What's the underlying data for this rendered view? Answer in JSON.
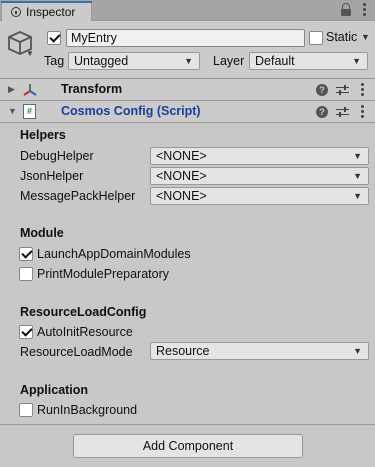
{
  "tab": {
    "label": "Inspector"
  },
  "header": {
    "object_name": "MyEntry",
    "active_checked": true,
    "static_label": "Static",
    "static_checked": false,
    "tag_label": "Tag",
    "tag_value": "Untagged",
    "layer_label": "Layer",
    "layer_value": "Default"
  },
  "components": {
    "transform": {
      "title": "Transform",
      "expanded": false
    },
    "cosmos": {
      "title": "Cosmos Config (Script)",
      "expanded": true,
      "enabled": false
    }
  },
  "sections": {
    "helpers": {
      "title": "Helpers",
      "fields": [
        {
          "label": "DebugHelper",
          "value": "<NONE>"
        },
        {
          "label": "JsonHelper",
          "value": "<NONE>"
        },
        {
          "label": "MessagePackHelper",
          "value": "<NONE>"
        }
      ]
    },
    "module": {
      "title": "Module",
      "toggles": [
        {
          "label": "LaunchAppDomainModules",
          "checked": true
        },
        {
          "label": "PrintModulePreparatory",
          "checked": false
        }
      ]
    },
    "resource": {
      "title": "ResourceLoadConfig",
      "toggles": [
        {
          "label": "AutoInitResource",
          "checked": true
        }
      ],
      "fields": [
        {
          "label": "ResourceLoadMode",
          "value": "Resource"
        }
      ]
    },
    "application": {
      "title": "Application",
      "toggles": [
        {
          "label": "RunInBackground",
          "checked": false
        }
      ]
    }
  },
  "add_component_label": "Add Component",
  "colors": {
    "accent": "#3a72b0",
    "script_title": "#1a3e9a",
    "panel_bg": "#c8c8c8"
  }
}
